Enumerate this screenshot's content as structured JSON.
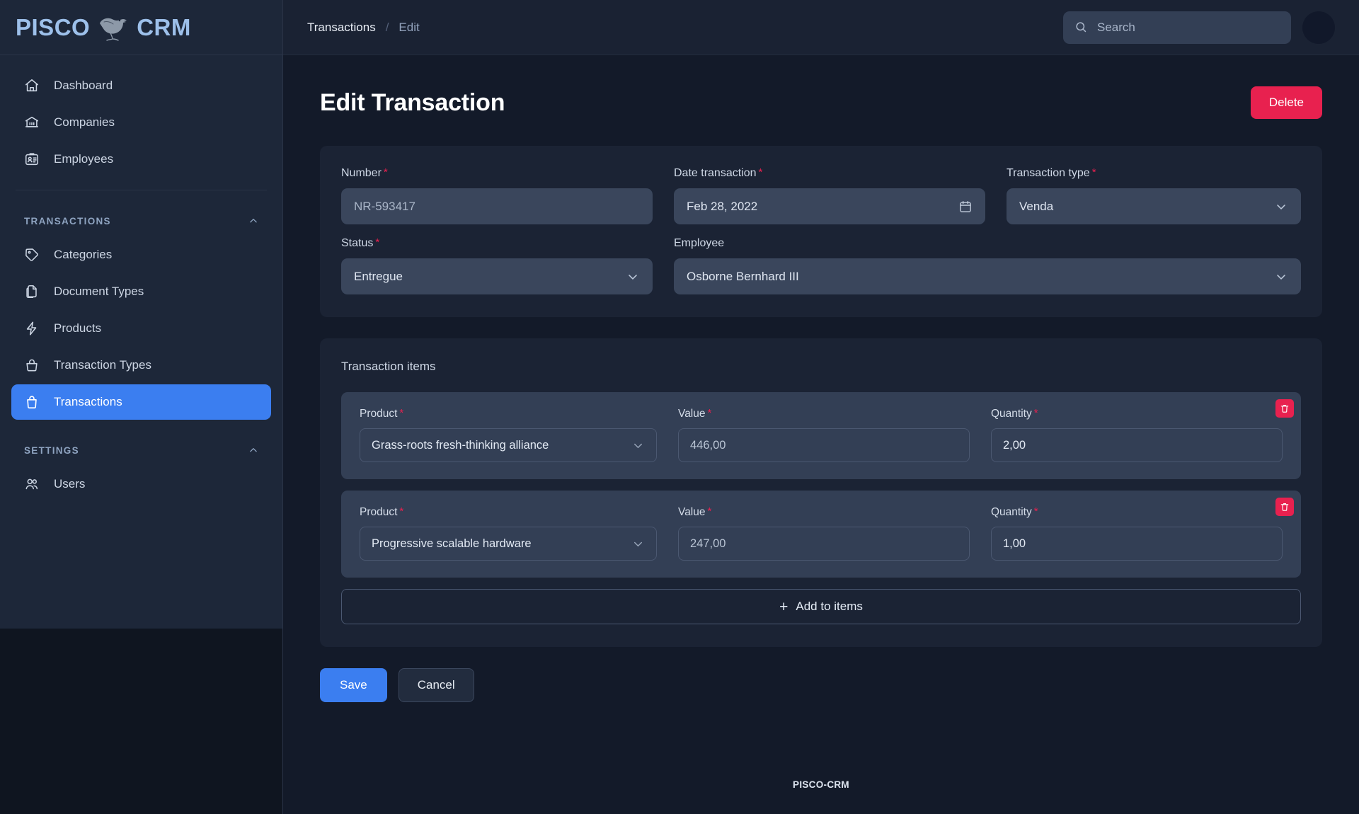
{
  "brand": {
    "name_left": "PISCO",
    "name_right": "CRM",
    "logo_icon": "bird-icon",
    "footer_text": "PISCO-CRM"
  },
  "sidebar": {
    "primary_items": [
      {
        "label": "Dashboard",
        "icon": "home-icon",
        "active": false
      },
      {
        "label": "Companies",
        "icon": "bank-icon",
        "active": false
      },
      {
        "label": "Employees",
        "icon": "id-badge-icon",
        "active": false
      }
    ],
    "groups": [
      {
        "title": "TRANSACTIONS",
        "collapse_icon": "chevron-up-icon",
        "items": [
          {
            "label": "Categories",
            "icon": "tag-icon",
            "active": false
          },
          {
            "label": "Document Types",
            "icon": "documents-icon",
            "active": false
          },
          {
            "label": "Products",
            "icon": "bolt-icon",
            "active": false
          },
          {
            "label": "Transaction Types",
            "icon": "basket-outline-icon",
            "active": false
          },
          {
            "label": "Transactions",
            "icon": "bag-icon",
            "active": true
          }
        ]
      },
      {
        "title": "SETTINGS",
        "collapse_icon": "chevron-up-icon",
        "items": [
          {
            "label": "Users",
            "icon": "users-icon",
            "active": false
          }
        ]
      }
    ]
  },
  "topbar": {
    "breadcrumb": {
      "parent": "Transactions",
      "separator": "/",
      "current": "Edit"
    },
    "search": {
      "value": "",
      "placeholder": "Search",
      "icon": "search-icon"
    },
    "avatar_icon": "avatar"
  },
  "page": {
    "title": "Edit Transaction",
    "delete_label": "Delete"
  },
  "form": {
    "number": {
      "label": "Number",
      "required": "*",
      "value": "NR-593417"
    },
    "date_transaction": {
      "label": "Date transaction",
      "required": "*",
      "value": "Feb 28, 2022",
      "icon": "calendar-icon"
    },
    "transaction_type": {
      "label": "Transaction type",
      "required": "*",
      "value": "Venda",
      "icon": "chevron-down-icon"
    },
    "status": {
      "label": "Status",
      "required": "*",
      "value": "Entregue",
      "icon": "chevron-down-icon"
    },
    "employee": {
      "label": "Employee",
      "required": "",
      "value": "Osborne Bernhard III",
      "icon": "chevron-down-icon"
    }
  },
  "items_section": {
    "label": "Transaction items",
    "columns": {
      "product": "Product",
      "value": "Value",
      "quantity": "Quantity"
    },
    "required_mark": "*",
    "delete_icon": "trash-icon",
    "rows": [
      {
        "product": "Grass-roots fresh-thinking alliance",
        "value": "446,00",
        "quantity": "2,00"
      },
      {
        "product": "Progressive scalable hardware",
        "value": "247,00",
        "quantity": "1,00"
      }
    ],
    "add_button": {
      "label": "Add to items",
      "icon": "plus-icon"
    }
  },
  "actions": {
    "save_label": "Save",
    "cancel_label": "Cancel"
  },
  "colors": {
    "accent_blue": "#3b7ef0",
    "danger_red": "#e8214f",
    "sidebar_bg": "#1d2739",
    "page_bg": "#131a29",
    "card_bg": "#1b2334",
    "control_bg": "#3a465c"
  }
}
